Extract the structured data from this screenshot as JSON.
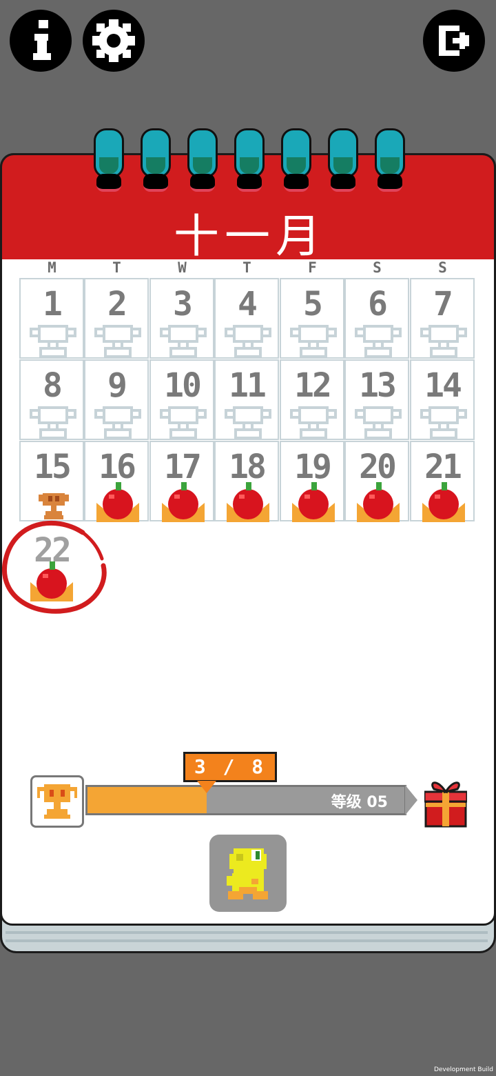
{
  "header": {
    "info_icon": "info-icon",
    "settings_icon": "gear-icon",
    "exit_icon": "exit-icon"
  },
  "calendar": {
    "month": "十一月",
    "weekdays": [
      "M",
      "T",
      "W",
      "T",
      "F",
      "S",
      "S"
    ],
    "days": [
      {
        "num": "1",
        "status": "empty"
      },
      {
        "num": "2",
        "status": "empty"
      },
      {
        "num": "3",
        "status": "empty"
      },
      {
        "num": "4",
        "status": "empty"
      },
      {
        "num": "5",
        "status": "empty"
      },
      {
        "num": "6",
        "status": "empty"
      },
      {
        "num": "7",
        "status": "empty"
      },
      {
        "num": "8",
        "status": "empty"
      },
      {
        "num": "9",
        "status": "empty"
      },
      {
        "num": "10",
        "status": "empty"
      },
      {
        "num": "11",
        "status": "empty"
      },
      {
        "num": "12",
        "status": "empty"
      },
      {
        "num": "13",
        "status": "empty"
      },
      {
        "num": "14",
        "status": "empty"
      },
      {
        "num": "15",
        "status": "bronze"
      },
      {
        "num": "16",
        "status": "apple"
      },
      {
        "num": "17",
        "status": "apple"
      },
      {
        "num": "18",
        "status": "apple"
      },
      {
        "num": "19",
        "status": "apple"
      },
      {
        "num": "20",
        "status": "apple"
      },
      {
        "num": "21",
        "status": "apple"
      }
    ],
    "today": {
      "num": "22",
      "status": "apple"
    }
  },
  "progress": {
    "count": "3 / 8",
    "fraction": 0.375,
    "level": "等级 05",
    "gift_icon": "gift-icon"
  },
  "colors": {
    "header_red": "#d11c1e",
    "progress_orange": "#f4a534",
    "background": "#676767"
  },
  "footer": {
    "dev_build": "Development Build"
  }
}
